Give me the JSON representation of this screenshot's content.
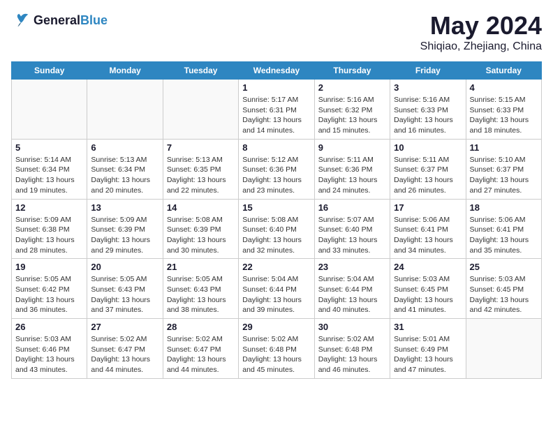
{
  "logo": {
    "line1": "General",
    "line2": "Blue"
  },
  "title": "May 2024",
  "location": "Shiqiao, Zhejiang, China",
  "days_of_week": [
    "Sunday",
    "Monday",
    "Tuesday",
    "Wednesday",
    "Thursday",
    "Friday",
    "Saturday"
  ],
  "weeks": [
    [
      {
        "num": "",
        "info": ""
      },
      {
        "num": "",
        "info": ""
      },
      {
        "num": "",
        "info": ""
      },
      {
        "num": "1",
        "info": "Sunrise: 5:17 AM\nSunset: 6:31 PM\nDaylight: 13 hours\nand 14 minutes."
      },
      {
        "num": "2",
        "info": "Sunrise: 5:16 AM\nSunset: 6:32 PM\nDaylight: 13 hours\nand 15 minutes."
      },
      {
        "num": "3",
        "info": "Sunrise: 5:16 AM\nSunset: 6:33 PM\nDaylight: 13 hours\nand 16 minutes."
      },
      {
        "num": "4",
        "info": "Sunrise: 5:15 AM\nSunset: 6:33 PM\nDaylight: 13 hours\nand 18 minutes."
      }
    ],
    [
      {
        "num": "5",
        "info": "Sunrise: 5:14 AM\nSunset: 6:34 PM\nDaylight: 13 hours\nand 19 minutes."
      },
      {
        "num": "6",
        "info": "Sunrise: 5:13 AM\nSunset: 6:34 PM\nDaylight: 13 hours\nand 20 minutes."
      },
      {
        "num": "7",
        "info": "Sunrise: 5:13 AM\nSunset: 6:35 PM\nDaylight: 13 hours\nand 22 minutes."
      },
      {
        "num": "8",
        "info": "Sunrise: 5:12 AM\nSunset: 6:36 PM\nDaylight: 13 hours\nand 23 minutes."
      },
      {
        "num": "9",
        "info": "Sunrise: 5:11 AM\nSunset: 6:36 PM\nDaylight: 13 hours\nand 24 minutes."
      },
      {
        "num": "10",
        "info": "Sunrise: 5:11 AM\nSunset: 6:37 PM\nDaylight: 13 hours\nand 26 minutes."
      },
      {
        "num": "11",
        "info": "Sunrise: 5:10 AM\nSunset: 6:37 PM\nDaylight: 13 hours\nand 27 minutes."
      }
    ],
    [
      {
        "num": "12",
        "info": "Sunrise: 5:09 AM\nSunset: 6:38 PM\nDaylight: 13 hours\nand 28 minutes."
      },
      {
        "num": "13",
        "info": "Sunrise: 5:09 AM\nSunset: 6:39 PM\nDaylight: 13 hours\nand 29 minutes."
      },
      {
        "num": "14",
        "info": "Sunrise: 5:08 AM\nSunset: 6:39 PM\nDaylight: 13 hours\nand 30 minutes."
      },
      {
        "num": "15",
        "info": "Sunrise: 5:08 AM\nSunset: 6:40 PM\nDaylight: 13 hours\nand 32 minutes."
      },
      {
        "num": "16",
        "info": "Sunrise: 5:07 AM\nSunset: 6:40 PM\nDaylight: 13 hours\nand 33 minutes."
      },
      {
        "num": "17",
        "info": "Sunrise: 5:06 AM\nSunset: 6:41 PM\nDaylight: 13 hours\nand 34 minutes."
      },
      {
        "num": "18",
        "info": "Sunrise: 5:06 AM\nSunset: 6:41 PM\nDaylight: 13 hours\nand 35 minutes."
      }
    ],
    [
      {
        "num": "19",
        "info": "Sunrise: 5:05 AM\nSunset: 6:42 PM\nDaylight: 13 hours\nand 36 minutes."
      },
      {
        "num": "20",
        "info": "Sunrise: 5:05 AM\nSunset: 6:43 PM\nDaylight: 13 hours\nand 37 minutes."
      },
      {
        "num": "21",
        "info": "Sunrise: 5:05 AM\nSunset: 6:43 PM\nDaylight: 13 hours\nand 38 minutes."
      },
      {
        "num": "22",
        "info": "Sunrise: 5:04 AM\nSunset: 6:44 PM\nDaylight: 13 hours\nand 39 minutes."
      },
      {
        "num": "23",
        "info": "Sunrise: 5:04 AM\nSunset: 6:44 PM\nDaylight: 13 hours\nand 40 minutes."
      },
      {
        "num": "24",
        "info": "Sunrise: 5:03 AM\nSunset: 6:45 PM\nDaylight: 13 hours\nand 41 minutes."
      },
      {
        "num": "25",
        "info": "Sunrise: 5:03 AM\nSunset: 6:45 PM\nDaylight: 13 hours\nand 42 minutes."
      }
    ],
    [
      {
        "num": "26",
        "info": "Sunrise: 5:03 AM\nSunset: 6:46 PM\nDaylight: 13 hours\nand 43 minutes."
      },
      {
        "num": "27",
        "info": "Sunrise: 5:02 AM\nSunset: 6:47 PM\nDaylight: 13 hours\nand 44 minutes."
      },
      {
        "num": "28",
        "info": "Sunrise: 5:02 AM\nSunset: 6:47 PM\nDaylight: 13 hours\nand 44 minutes."
      },
      {
        "num": "29",
        "info": "Sunrise: 5:02 AM\nSunset: 6:48 PM\nDaylight: 13 hours\nand 45 minutes."
      },
      {
        "num": "30",
        "info": "Sunrise: 5:02 AM\nSunset: 6:48 PM\nDaylight: 13 hours\nand 46 minutes."
      },
      {
        "num": "31",
        "info": "Sunrise: 5:01 AM\nSunset: 6:49 PM\nDaylight: 13 hours\nand 47 minutes."
      },
      {
        "num": "",
        "info": ""
      }
    ]
  ]
}
